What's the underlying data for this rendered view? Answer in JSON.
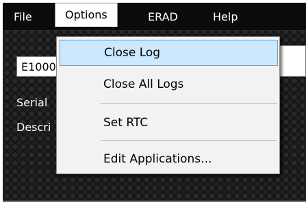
{
  "menubar": {
    "file": "File",
    "options": "Options",
    "erad": "ERAD",
    "help": "Help"
  },
  "fields": {
    "id_value": "E1000"
  },
  "labels": {
    "serial": "Serial",
    "description": "Descri"
  },
  "options_menu": {
    "items": [
      {
        "label": "Close Log",
        "highlighted": true
      },
      {
        "label": "Close All Logs"
      },
      {
        "label": "Set RTC"
      },
      {
        "label": "Edit Applications..."
      }
    ]
  },
  "colors": {
    "background": "#161616",
    "menubar": "#0b0b0b",
    "highlight": "#cce8ff",
    "highlight_border": "#5aa0e6",
    "menu_bg": "#f2f2f2"
  }
}
